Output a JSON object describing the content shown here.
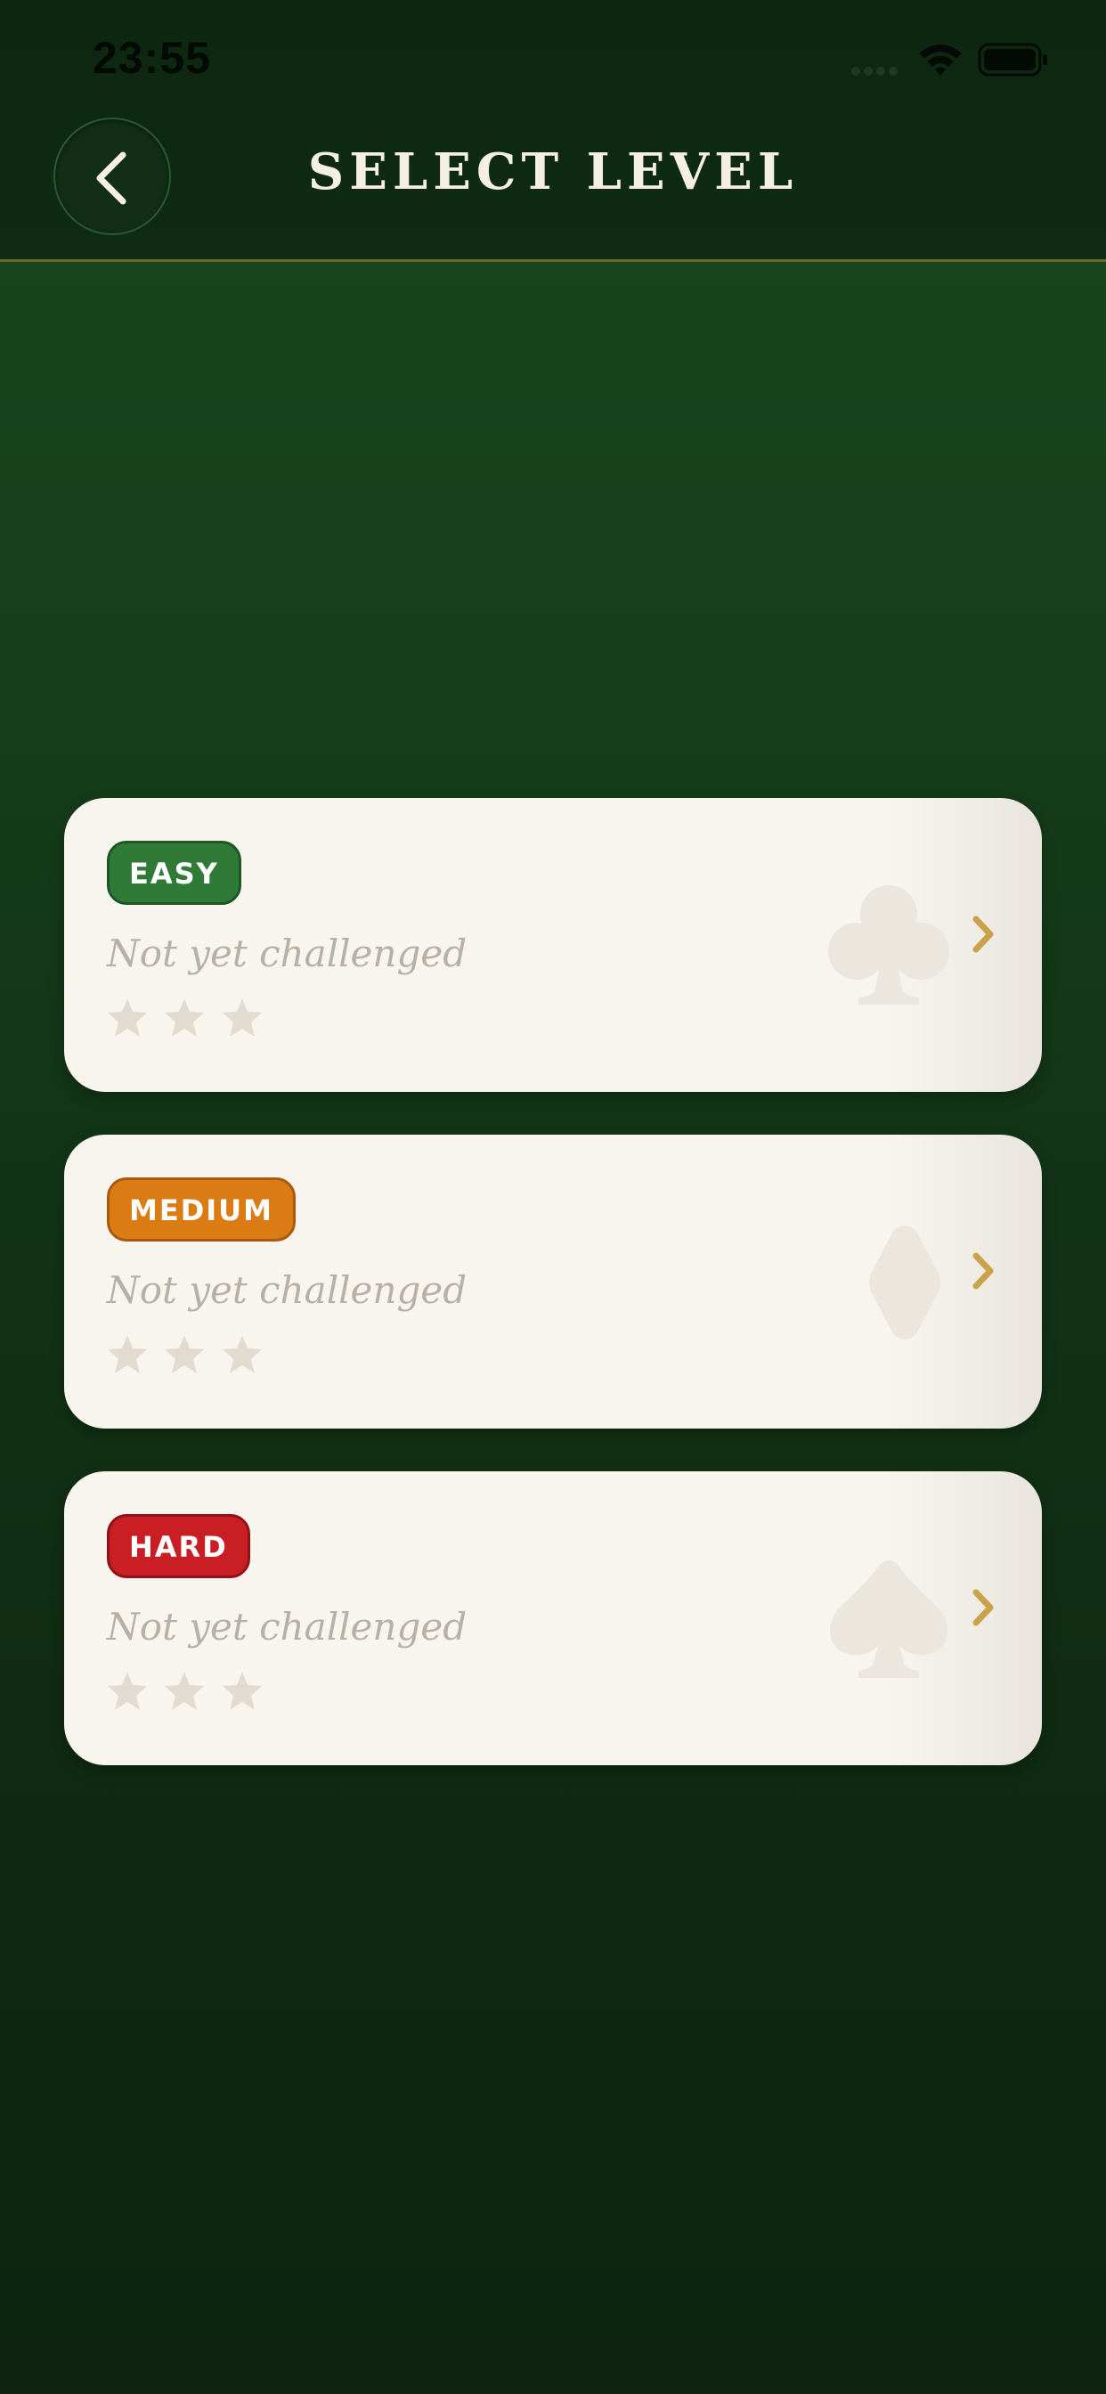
{
  "status_bar": {
    "time": "23:55"
  },
  "header": {
    "title": "SELECT LEVEL"
  },
  "levels": [
    {
      "badge": "EASY",
      "status": "Not yet challenged",
      "stars_earned": 0,
      "stars_total": 3,
      "suit": "club-icon",
      "badge_color": "#2e7a36"
    },
    {
      "badge": "MEDIUM",
      "status": "Not yet challenged",
      "stars_earned": 0,
      "stars_total": 3,
      "suit": "diamond-icon",
      "badge_color": "#db7b14"
    },
    {
      "badge": "HARD",
      "status": "Not yet challenged",
      "stars_earned": 0,
      "stars_total": 3,
      "suit": "spade-icon",
      "badge_color": "#c91e24"
    }
  ],
  "colors": {
    "felt_green": "#17401a",
    "card_bg": "#f8f5ef",
    "accent_gold": "#c9a24a",
    "muted_text": "#b7b0a7",
    "star_empty": "#e3dbd0"
  }
}
